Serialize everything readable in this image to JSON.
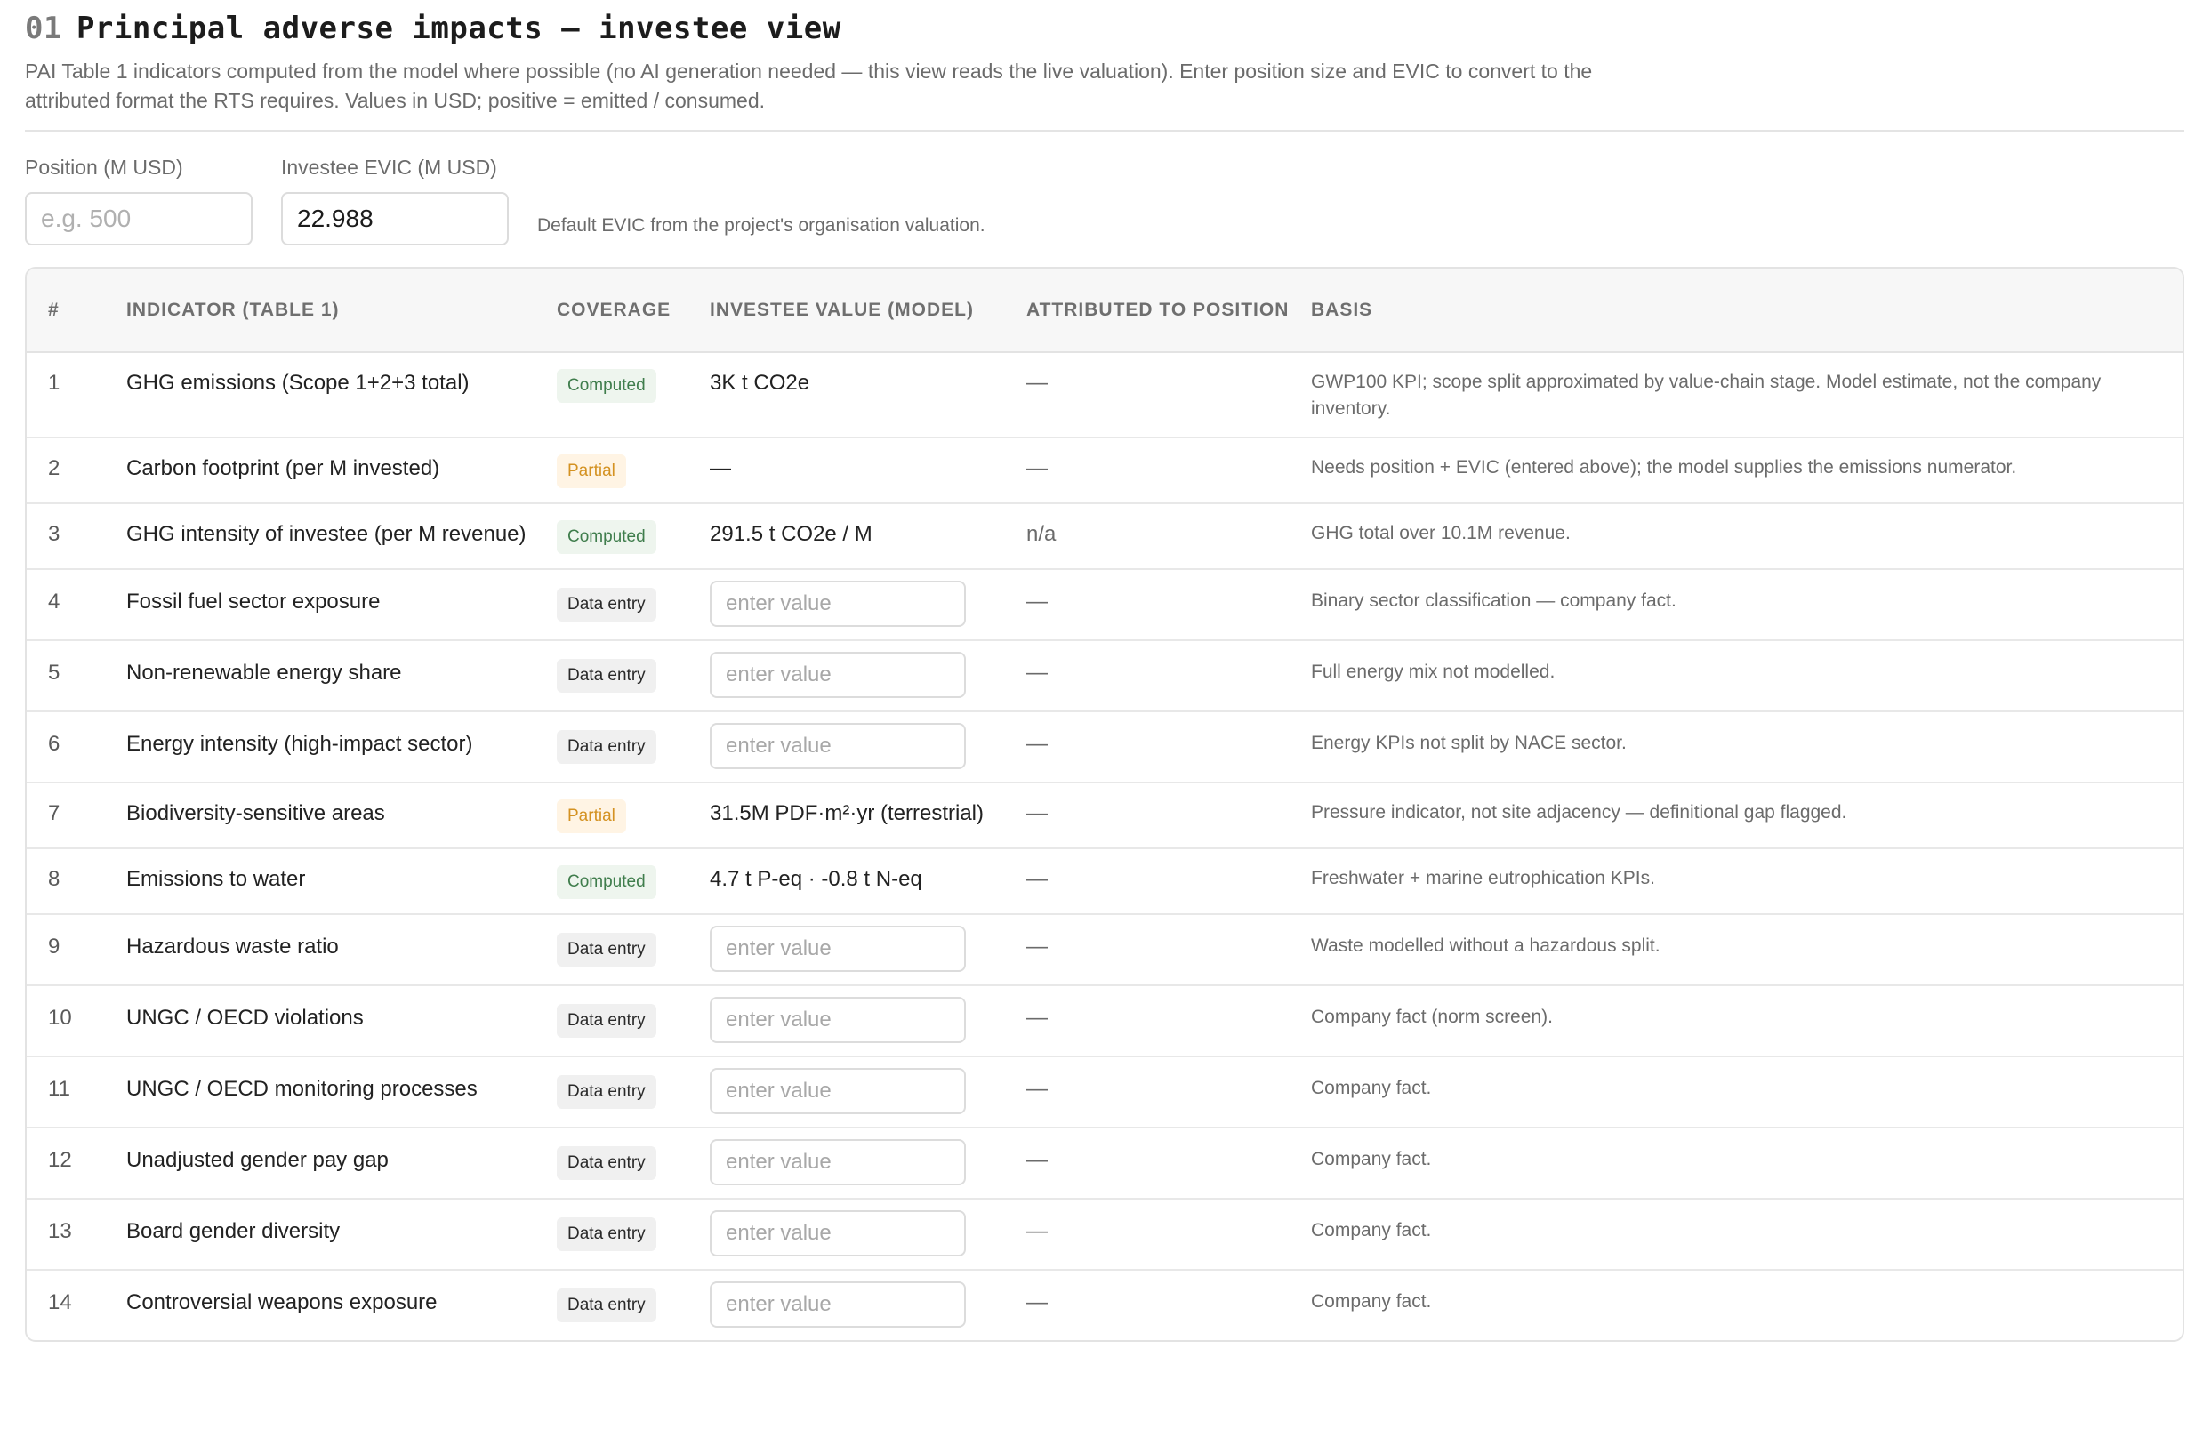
{
  "header": {
    "number": "01",
    "title": "Principal adverse impacts — investee view",
    "subtitle": "PAI Table 1 indicators computed from the model where possible (no AI generation needed — this view reads the live valuation). Enter position size and EVIC to convert to the attributed format the RTS requires. Values in USD; positive = emitted / consumed."
  },
  "inputs": {
    "position_label": "Position (M USD)",
    "position_value": "",
    "position_placeholder": "e.g. 500",
    "evic_label": "Investee EVIC (M USD)",
    "evic_value": "22.988",
    "evic_placeholder": "",
    "hint": "Default EVIC from the project's organisation valuation."
  },
  "table": {
    "columns": [
      "#",
      "Indicator (Table 1)",
      "Coverage",
      "Investee value (model)",
      "Attributed to position",
      "Basis"
    ],
    "input_placeholder": "enter value",
    "rows": [
      {
        "num": "1",
        "indicator": "GHG emissions (Scope 1+2+3 total)",
        "coverage": "Computed",
        "investee": "3K t CO2e",
        "attributed": "—",
        "basis": "GWP100 KPI; scope split approximated by value-chain stage. Model estimate, not the company inventory."
      },
      {
        "num": "2",
        "indicator": "Carbon footprint (per M invested)",
        "coverage": "Partial",
        "investee": "—",
        "attributed": "—",
        "basis": "Needs position + EVIC (entered above); the model supplies the emissions numerator."
      },
      {
        "num": "3",
        "indicator": "GHG intensity of investee (per M revenue)",
        "coverage": "Computed",
        "investee": "291.5 t CO2e / M",
        "attributed": "n/a",
        "basis": "GHG total over 10.1M revenue."
      },
      {
        "num": "4",
        "indicator": "Fossil fuel sector exposure",
        "coverage": "Data entry",
        "investee": "",
        "attributed": "—",
        "basis": "Binary sector classification — company fact."
      },
      {
        "num": "5",
        "indicator": "Non-renewable energy share",
        "coverage": "Data entry",
        "investee": "",
        "attributed": "—",
        "basis": "Full energy mix not modelled."
      },
      {
        "num": "6",
        "indicator": "Energy intensity (high-impact sector)",
        "coverage": "Data entry",
        "investee": "",
        "attributed": "—",
        "basis": "Energy KPIs not split by NACE sector."
      },
      {
        "num": "7",
        "indicator": "Biodiversity-sensitive areas",
        "coverage": "Partial",
        "investee": "31.5M PDF·m²·yr (terrestrial)",
        "attributed": "—",
        "basis": "Pressure indicator, not site adjacency — definitional gap flagged."
      },
      {
        "num": "8",
        "indicator": "Emissions to water",
        "coverage": "Computed",
        "investee": "4.7 t P-eq · -0.8 t N-eq",
        "attributed": "—",
        "basis": "Freshwater + marine eutrophication KPIs."
      },
      {
        "num": "9",
        "indicator": "Hazardous waste ratio",
        "coverage": "Data entry",
        "investee": "",
        "attributed": "—",
        "basis": "Waste modelled without a hazardous split."
      },
      {
        "num": "10",
        "indicator": "UNGC / OECD violations",
        "coverage": "Data entry",
        "investee": "",
        "attributed": "—",
        "basis": "Company fact (norm screen)."
      },
      {
        "num": "11",
        "indicator": "UNGC / OECD monitoring processes",
        "coverage": "Data entry",
        "investee": "",
        "attributed": "—",
        "basis": "Company fact."
      },
      {
        "num": "12",
        "indicator": "Unadjusted gender pay gap",
        "coverage": "Data entry",
        "investee": "",
        "attributed": "—",
        "basis": "Company fact."
      },
      {
        "num": "13",
        "indicator": "Board gender diversity",
        "coverage": "Data entry",
        "investee": "",
        "attributed": "—",
        "basis": "Company fact."
      },
      {
        "num": "14",
        "indicator": "Controversial weapons exposure",
        "coverage": "Data entry",
        "investee": "",
        "attributed": "—",
        "basis": "Company fact."
      }
    ]
  },
  "colors": {
    "computed_text": "#3f7d4c",
    "computed_bg": "#eef5ee",
    "partial_text": "#d49222",
    "partial_bg": "#fff4e4",
    "data_text": "#2a2a2a",
    "data_bg": "#f0f0f0"
  }
}
